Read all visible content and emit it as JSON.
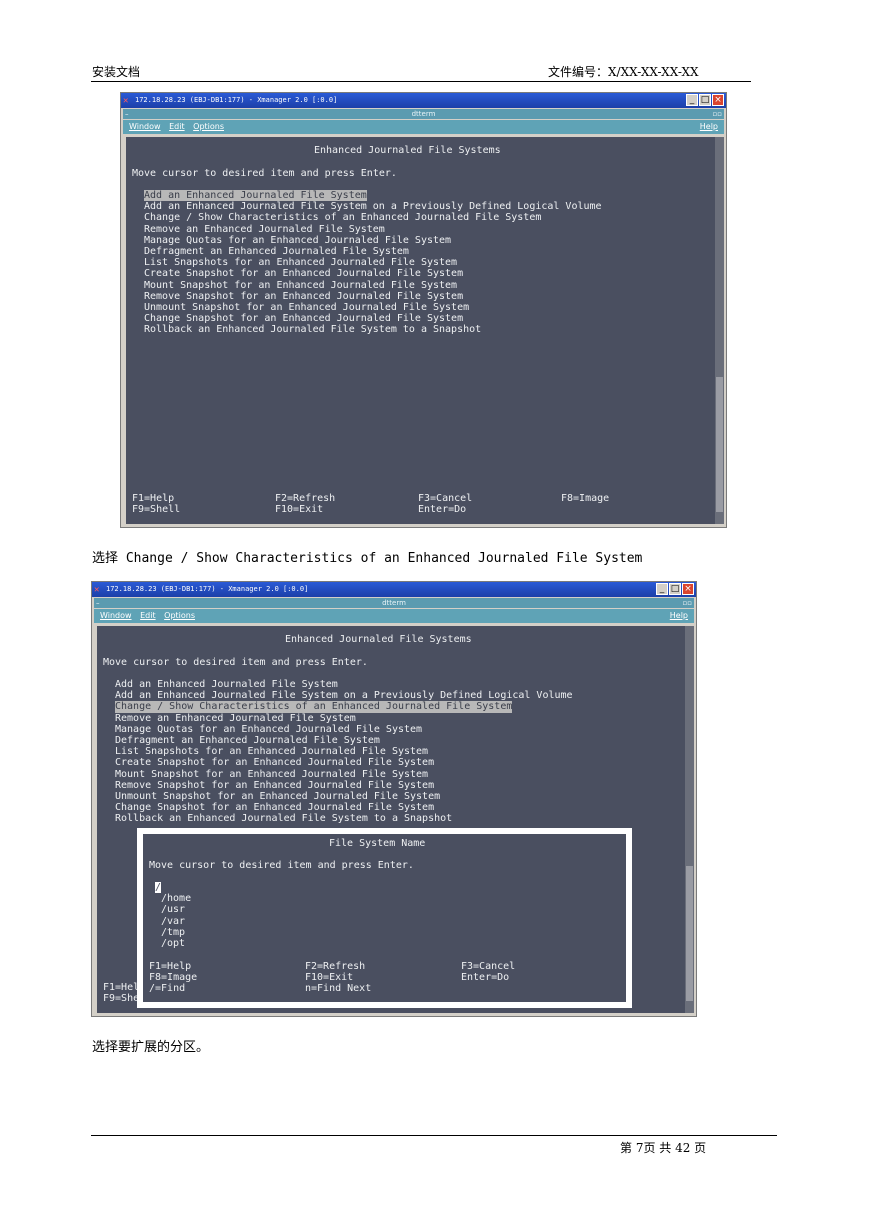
{
  "header": {
    "left": "安装文档",
    "right": "文件编号：X/XX-XX-XX-XX"
  },
  "footer": {
    "text": "第 7页  共 42 页"
  },
  "captions": {
    "first": "选择 Change / Show Characteristics of an Enhanced Journaled File System",
    "second": "选择要扩展的分区。"
  },
  "window": {
    "title": "172.18.28.23 (EBJ-DB1:177) - Xmanager 2.0 [:0.0]",
    "dtterm": "dtterm",
    "menus": [
      "Window",
      "Edit",
      "Options"
    ],
    "help": "Help"
  },
  "screen": {
    "heading": "Enhanced Journaled File Systems",
    "prompt": "Move cursor to desired item and press Enter.",
    "items": [
      "Add an Enhanced Journaled File System",
      "Add an Enhanced Journaled File System on a Previously Defined Logical Volume",
      "Change / Show Characteristics of an Enhanced Journaled File System",
      "Remove an Enhanced Journaled File System",
      "Manage Quotas for an Enhanced Journaled File System",
      "Defragment an Enhanced Journaled File System",
      "List Snapshots for an Enhanced Journaled File System",
      "Create Snapshot for an Enhanced Journaled File System",
      "Mount Snapshot for an Enhanced Journaled File System",
      "Remove Snapshot for an Enhanced Journaled File System",
      "Unmount Snapshot for an Enhanced Journaled File System",
      "Change Snapshot for an Enhanced Journaled File System",
      "Rollback an Enhanced Journaled File System to a Snapshot"
    ],
    "keys1": {
      "f1": "F1=Help",
      "f2": "F2=Refresh",
      "f3": "F3=Cancel",
      "f8": "F8=Image",
      "f9": "F9=Shell",
      "f10": "F10=Exit",
      "enter": "Enter=Do"
    },
    "keys2_partial": {
      "f1": "F1=Hel",
      "f9": "F9=She"
    }
  },
  "popup": {
    "heading": "File System Name",
    "prompt": "Move cursor to desired item and press Enter.",
    "options": [
      "/",
      "/home",
      "/usr",
      "/var",
      "/tmp",
      "/opt"
    ],
    "keys": {
      "f1": "F1=Help",
      "f2": "F2=Refresh",
      "f3": "F3=Cancel",
      "f8": "F8=Image",
      "f10": "F10=Exit",
      "enter": "Enter=Do",
      "find": "/=Find",
      "next": "n=Find Next"
    }
  }
}
